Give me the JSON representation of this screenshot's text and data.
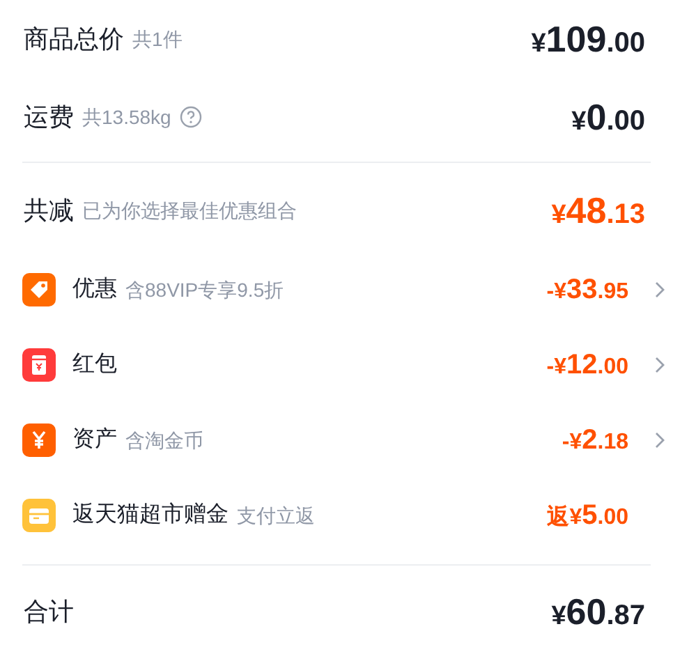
{
  "summary": [
    {
      "label": "商品总价",
      "note": "共1件",
      "info": false,
      "highlight": false,
      "amount": {
        "symbol": "¥",
        "main": "109",
        "fraction": ".00"
      }
    },
    {
      "label": "运费",
      "note": "共13.58kg",
      "info": true,
      "highlight": false,
      "amount": {
        "symbol": "¥",
        "main": "0",
        "fraction": ".00"
      }
    }
  ],
  "discount": {
    "label": "共减",
    "note": "已为你选择最佳优惠组合",
    "highlight": true,
    "amount": {
      "symbol": "¥",
      "main": "48",
      "fraction": ".13"
    }
  },
  "items": [
    {
      "kind": "tag",
      "label": "优惠",
      "note": "含88VIP专享9.5折",
      "chevron": true,
      "amount": {
        "symbol": "-¥",
        "main": "33",
        "fraction": ".95"
      }
    },
    {
      "kind": "red_packet",
      "label": "红包",
      "chevron": true,
      "amount": {
        "symbol": "-¥",
        "main": "12",
        "fraction": ".00"
      }
    },
    {
      "kind": "yen",
      "label": "资产",
      "note": "含淘金币",
      "chevron": true,
      "amount": {
        "symbol": "-¥",
        "main": "2",
        "fraction": ".18"
      }
    },
    {
      "kind": "card",
      "label": "返天猫超市赠金",
      "note": "支付立返",
      "chevron": false,
      "amount": {
        "symbol": "返¥",
        "main": "5",
        "fraction": ".00"
      }
    }
  ],
  "total": {
    "label": "合计",
    "amount": {
      "symbol": "¥",
      "main": "60",
      "fraction": ".87"
    }
  }
}
